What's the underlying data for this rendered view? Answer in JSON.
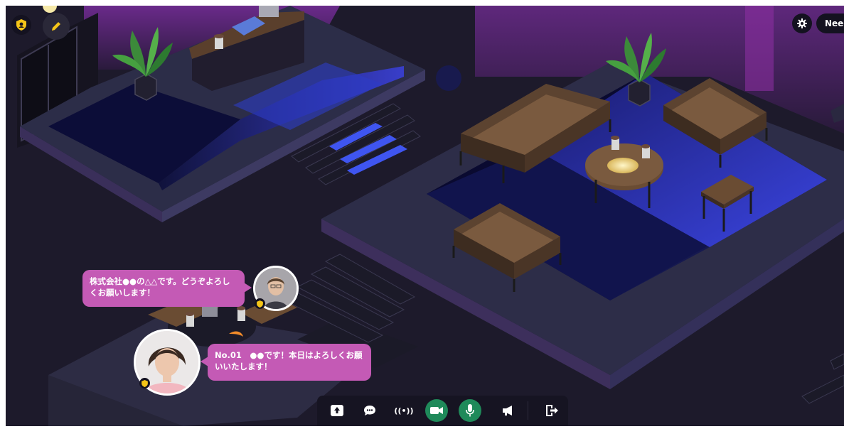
{
  "top_bar": {
    "need_label": "Need",
    "icons": {
      "shield": "shield-icon",
      "edit": "pencil-icon",
      "settings": "gear-icon"
    }
  },
  "chat_bubbles": [
    {
      "speaker_avatar": "avatar-1",
      "text": "株式会社●●の△△です。どうぞよろしくお願いします！"
    },
    {
      "speaker_avatar": "avatar-2",
      "text": "No.01　●●です！本日はよろしくお願いいたします！"
    }
  ],
  "toolbar": {
    "broadcast_label": "((•))",
    "icons": [
      "share-screen-icon",
      "chat-icon",
      "broadcast-icon",
      "camera-icon",
      "microphone-icon",
      "megaphone-icon",
      "exit-icon"
    ],
    "active_color": "#1f8a5a"
  },
  "colors": {
    "bubble": "#c45ab5",
    "background": "#1d1a2b",
    "floor_glow": "#3a3fd6",
    "accent_yellow": "#f5c518"
  }
}
